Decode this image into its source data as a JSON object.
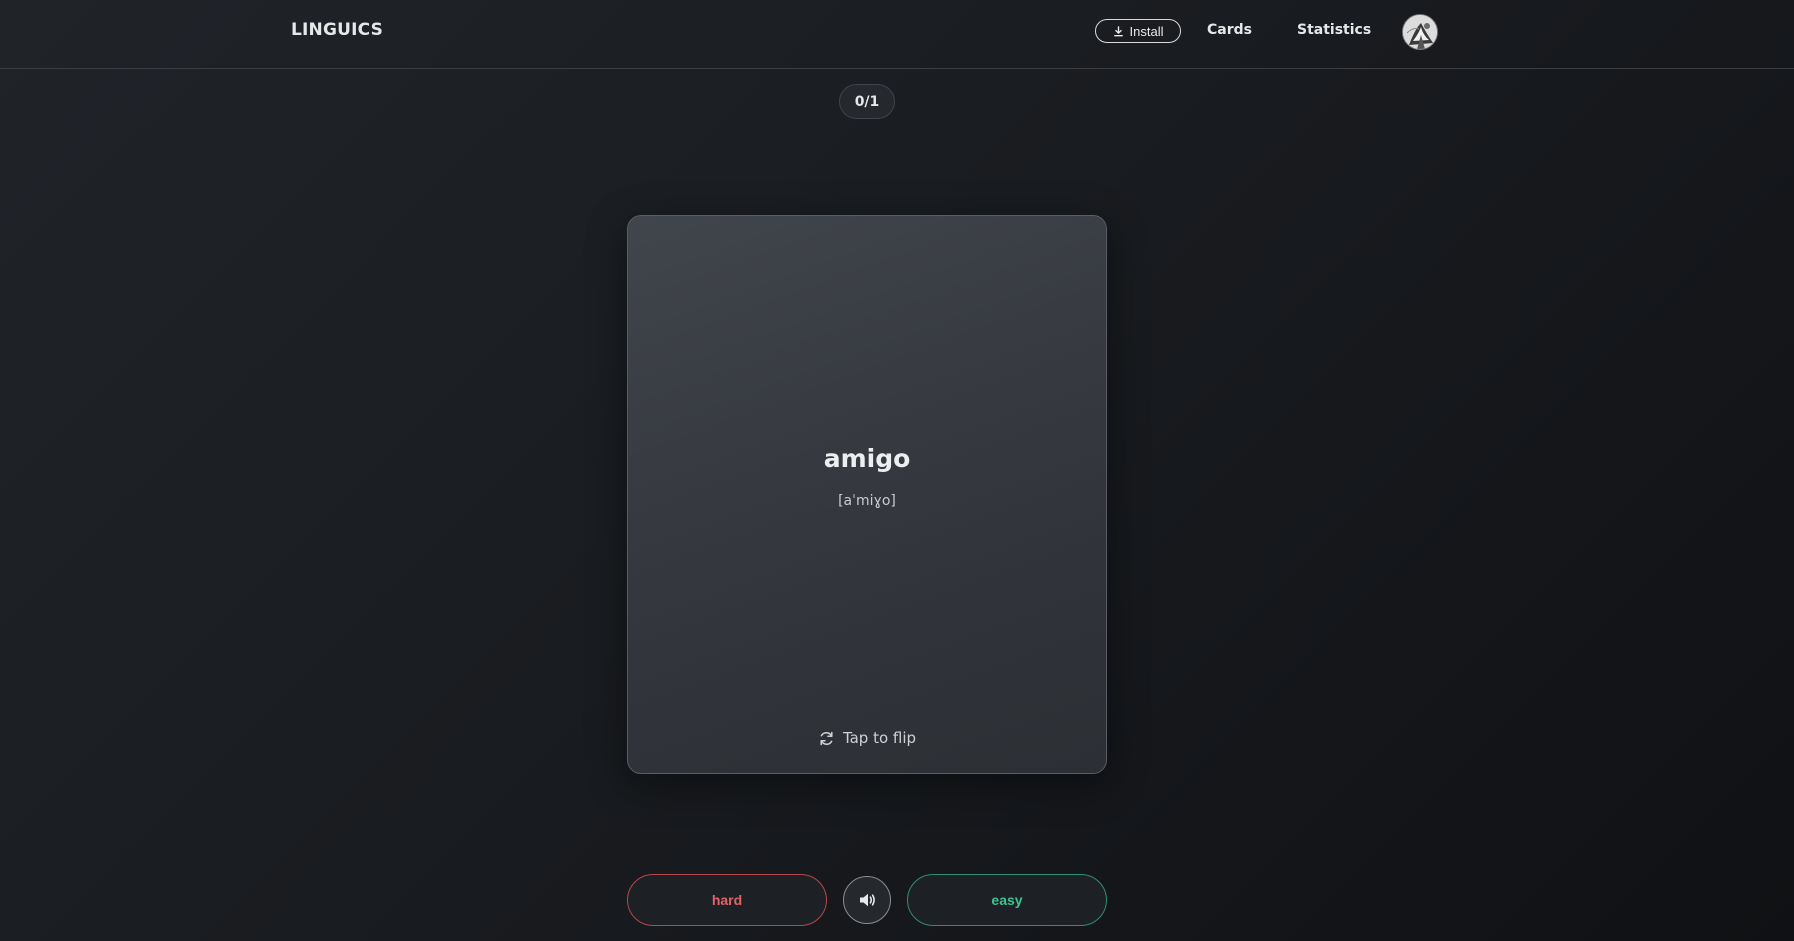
{
  "header": {
    "brand": "LINGUICS",
    "install_label": "Install",
    "nav": {
      "cards": "Cards",
      "statistics": "Statistics"
    }
  },
  "progress": {
    "label": "0/1",
    "done": 0,
    "total": 1
  },
  "card": {
    "word": "amigo",
    "phonetic": "[aˈmiɣo]",
    "flip_hint": "Tap to flip"
  },
  "actions": {
    "hard_label": "hard",
    "easy_label": "easy"
  },
  "colors": {
    "hard": "#e06467",
    "easy": "#3fc28f",
    "background": "#1a1d21",
    "card": "#383c42"
  },
  "icons": {
    "install": "download-icon",
    "flip": "refresh-icon",
    "audio": "speaker-icon"
  }
}
